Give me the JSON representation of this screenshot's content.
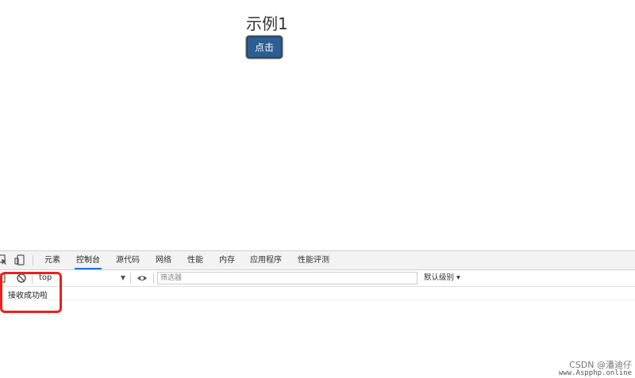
{
  "page": {
    "heading": "示例1",
    "button_label": "点击"
  },
  "devtools": {
    "tabs": [
      {
        "label": "元素",
        "active": false
      },
      {
        "label": "控制台",
        "active": true
      },
      {
        "label": "源代码",
        "active": false
      },
      {
        "label": "网络",
        "active": false
      },
      {
        "label": "性能",
        "active": false
      },
      {
        "label": "内存",
        "active": false
      },
      {
        "label": "应用程序",
        "active": false
      },
      {
        "label": "性能评测",
        "active": false
      }
    ],
    "toolbar": {
      "context": "top",
      "filter_placeholder": "筛选器",
      "filter_value": "",
      "level_label": "默认级别 ▾"
    },
    "console": {
      "messages": [
        "接收成功啦"
      ]
    }
  },
  "watermark": {
    "text": "CSDN @潘迪仔",
    "url": "www.Aspphp.online"
  },
  "colors": {
    "button_bg": "#2b5e93",
    "active_tab_underline": "#1a73e8",
    "highlight_box": "#e8211d"
  }
}
